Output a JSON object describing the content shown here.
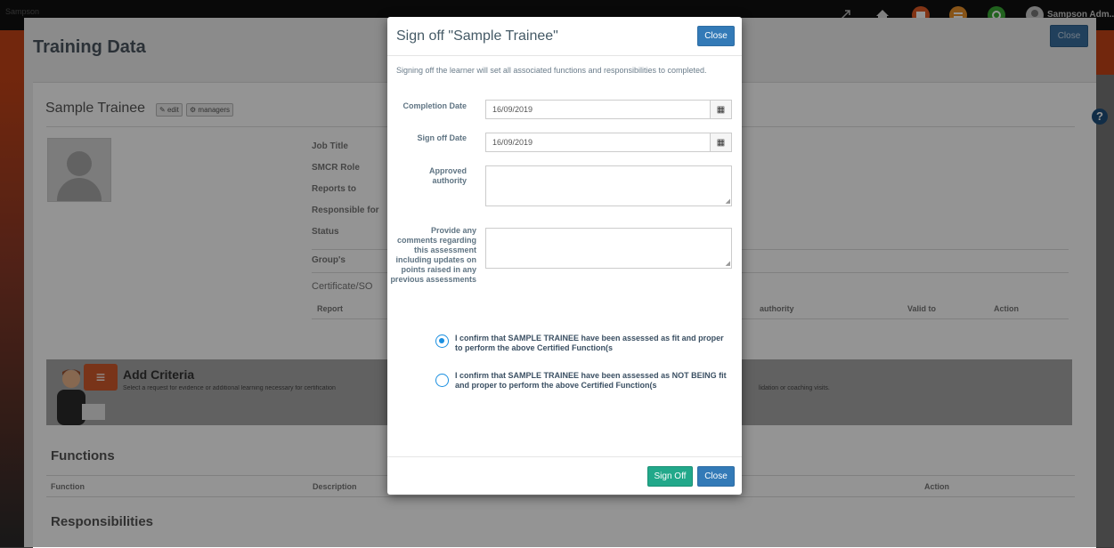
{
  "app": {
    "brand": "Sampson",
    "user_label": "Sampson Adm...",
    "topbar_icons": [
      "expand-icon",
      "home-icon",
      "inbox-icon",
      "courses-icon",
      "help-circle-icon",
      "user-icon"
    ]
  },
  "page": {
    "title": "Training Data",
    "close_label": "Close",
    "help_glyph": "?"
  },
  "trainee": {
    "name": "Sample Trainee",
    "edit_label": "edit",
    "managers_label": "managers",
    "fields": [
      "Job Title",
      "SMCR Role",
      "Reports to",
      "Responsible for",
      "Status",
      "Group's"
    ],
    "certificate_label": "Certificate/SO",
    "cert_table_headers": {
      "report": "Report",
      "authority": "authority",
      "valid_to": "Valid to",
      "action": "Action"
    }
  },
  "criteria": {
    "title": "Add Criteria",
    "description": "Select a request for evidence or additional learning necessary for certification",
    "description_tail": "lidation or coaching visits."
  },
  "functions": {
    "title": "Functions",
    "headers": {
      "function": "Function",
      "description": "Description",
      "action": "Action"
    }
  },
  "responsibilities": {
    "title": "Responsibilities"
  },
  "modal": {
    "title": "Sign off \"Sample Trainee\"",
    "close_label": "Close",
    "intro": "Signing off the learner will set all associated functions and responsibilities to completed.",
    "completion_date_label": "Completion Date",
    "completion_date_value": "16/09/2019",
    "signoff_date_label": "Sign off Date",
    "signoff_date_value": "16/09/2019",
    "approved_authority_label": "Approved authority",
    "comments_label": "Provide any comments regarding this assessment including updates on points raised in any previous assessments",
    "option_fit": "I confirm that SAMPLE TRAINEE have been assessed as fit and proper to perform the above Certified Function(s",
    "option_not_fit": "I confirm that SAMPLE TRAINEE have been assessed as NOT BEING fit and proper to perform the above Certified Function(s",
    "selected_option": "fit",
    "signoff_label": "Sign Off",
    "close_bottom_label": "Close",
    "colors": {
      "primary": "#337ab7",
      "success": "#22a88a",
      "radio": "#1a8fe0"
    }
  }
}
